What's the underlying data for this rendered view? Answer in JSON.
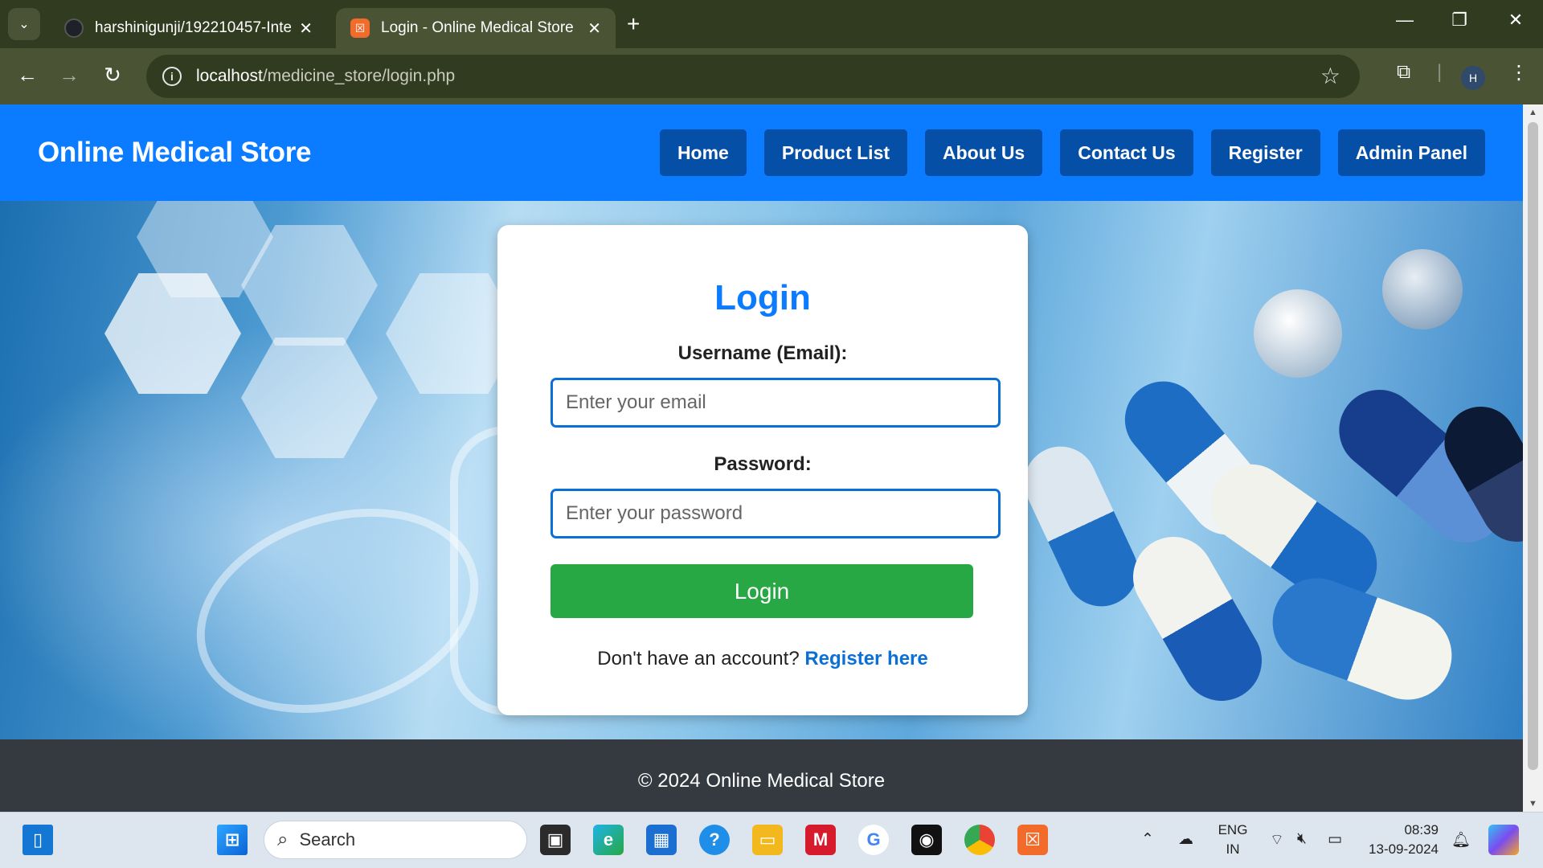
{
  "browser": {
    "tabs": [
      {
        "title": "harshinigunji/192210457-Intern",
        "active": false
      },
      {
        "title": "Login - Online Medical Store",
        "active": true
      }
    ],
    "url_host": "localhost",
    "url_path": "/medicine_store/login.php",
    "profile_initial": "H"
  },
  "site": {
    "brand": "Online Medical Store",
    "nav": [
      "Home",
      "Product List",
      "About Us",
      "Contact Us",
      "Register",
      "Admin Panel"
    ],
    "footer": "© 2024 Online Medical Store"
  },
  "login": {
    "title": "Login",
    "email_label": "Username (Email):",
    "email_placeholder": "Enter your email",
    "password_label": "Password:",
    "password_placeholder": "Enter your password",
    "button": "Login",
    "signup_text": "Don't have an account?",
    "signup_link": "Register here"
  },
  "taskbar": {
    "search_placeholder": "Search",
    "lang_top": "ENG",
    "lang_bottom": "IN",
    "time": "08:39",
    "date": "13-09-2024"
  },
  "colors": {
    "header": "#0b7bff",
    "nav_button": "#0550a6",
    "login_button": "#28a745",
    "footer": "#343a40"
  }
}
